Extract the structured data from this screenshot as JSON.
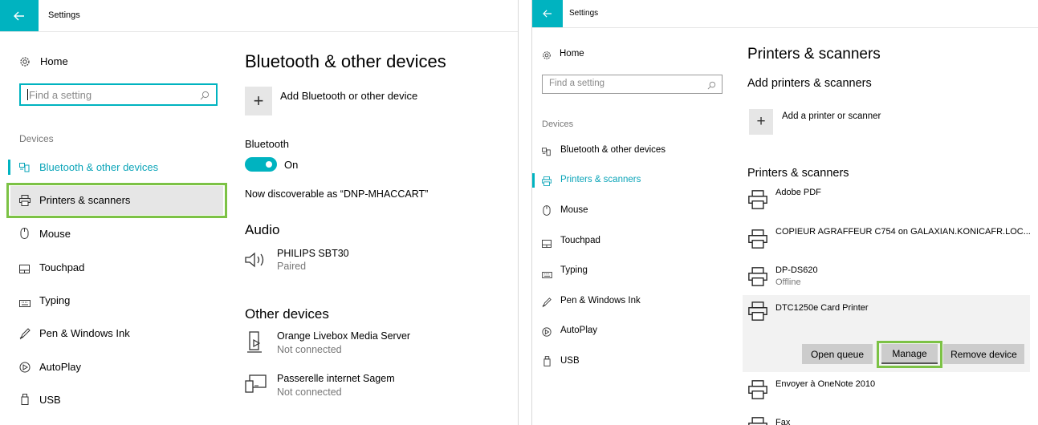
{
  "left": {
    "window_title": "Settings",
    "nav": {
      "home": "Home",
      "search_placeholder": "Find a setting",
      "section": "Devices",
      "items": [
        {
          "label": "Bluetooth & other devices",
          "icon": "bluetooth-devices-icon",
          "selected": true
        },
        {
          "label": "Printers & scanners",
          "icon": "printer-icon",
          "highlighted": true
        },
        {
          "label": "Mouse",
          "icon": "mouse-icon"
        },
        {
          "label": "Touchpad",
          "icon": "touchpad-icon"
        },
        {
          "label": "Typing",
          "icon": "keyboard-icon"
        },
        {
          "label": "Pen & Windows Ink",
          "icon": "pen-icon"
        },
        {
          "label": "AutoPlay",
          "icon": "autoplay-icon"
        },
        {
          "label": "USB",
          "icon": "usb-icon"
        }
      ]
    },
    "content": {
      "title": "Bluetooth & other devices",
      "add_label": "Add Bluetooth or other device",
      "bluetooth_heading": "Bluetooth",
      "toggle_state": "On",
      "discoverable": "Now discoverable as “DNP-MHACCART”",
      "audio_heading": "Audio",
      "audio_device": {
        "name": "PHILIPS SBT30",
        "status": "Paired"
      },
      "other_heading": "Other devices",
      "other_devices": [
        {
          "name": "Orange Livebox Media Server",
          "status": "Not connected",
          "icon": "media-server-icon"
        },
        {
          "name": "Passerelle internet Sagem",
          "status": "Not connected",
          "icon": "gateway-icon"
        }
      ]
    }
  },
  "right": {
    "window_title": "Settings",
    "nav": {
      "home": "Home",
      "search_placeholder": "Find a setting",
      "section": "Devices",
      "items": [
        {
          "label": "Bluetooth & other devices",
          "icon": "bluetooth-devices-icon"
        },
        {
          "label": "Printers & scanners",
          "icon": "printer-icon",
          "selected": true
        },
        {
          "label": "Mouse",
          "icon": "mouse-icon"
        },
        {
          "label": "Touchpad",
          "icon": "touchpad-icon"
        },
        {
          "label": "Typing",
          "icon": "keyboard-icon"
        },
        {
          "label": "Pen & Windows Ink",
          "icon": "pen-icon"
        },
        {
          "label": "AutoPlay",
          "icon": "autoplay-icon"
        },
        {
          "label": "USB",
          "icon": "usb-icon"
        }
      ]
    },
    "content": {
      "title": "Printers & scanners",
      "add_heading": "Add printers & scanners",
      "add_label": "Add a printer or scanner",
      "list_heading": "Printers & scanners",
      "printers": [
        {
          "name": "Adobe PDF",
          "status": ""
        },
        {
          "name": "COPIEUR AGRAFFEUR C754 on GALAXIAN.KONICAFR.LOC...",
          "status": ""
        },
        {
          "name": "DP-DS620",
          "status": "Offline"
        },
        {
          "name": "DTC1250e Card Printer",
          "status": "",
          "selected": true
        },
        {
          "name": "Envoyer à OneNote 2010",
          "status": ""
        },
        {
          "name": "Fax",
          "status": ""
        }
      ],
      "buttons": {
        "open_queue": "Open queue",
        "manage": "Manage",
        "remove": "Remove device"
      }
    }
  },
  "colors": {
    "accent": "#00b3c0",
    "highlight": "#7cc245",
    "button": "#cccccc",
    "selected_bg": "#f2f2f2"
  }
}
